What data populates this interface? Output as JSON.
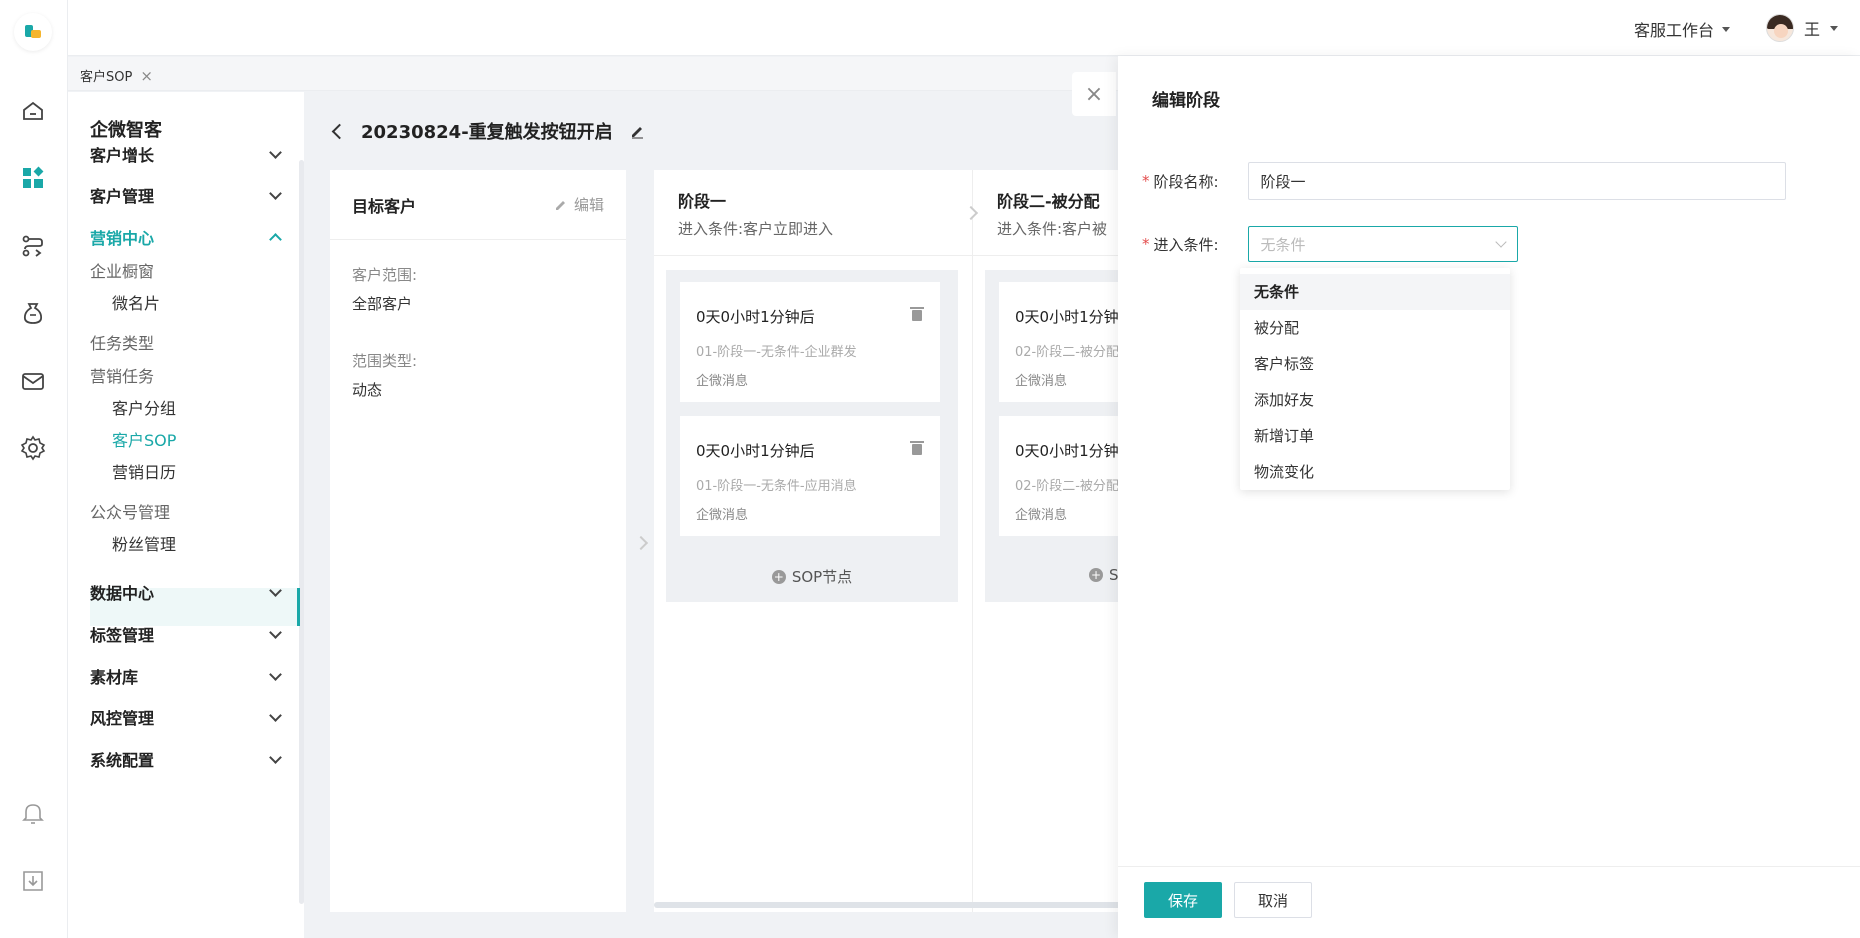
{
  "topbar": {
    "workbench_label": "客服工作台",
    "user_name": "王"
  },
  "tabs": [
    {
      "label": "客户SOP"
    }
  ],
  "menu": {
    "brand": "企微智客",
    "groups": {
      "growth": "客户增长",
      "manage": "客户管理",
      "marketing": "营销中心",
      "data": "数据中心",
      "tags": "标签管理",
      "materials": "素材库",
      "risk": "风控管理",
      "system": "系统配置"
    },
    "subs": {
      "showcase": "企业橱窗",
      "card": "微名片",
      "task_type": "任务类型",
      "task": "营销任务",
      "group": "客户分组",
      "sop": "客户SOP",
      "calendar": "营销日历",
      "mp": "公众号管理",
      "fans": "粉丝管理"
    }
  },
  "page": {
    "title": "20230824-重复触发按钮开启",
    "target_card": {
      "title": "目标客户",
      "edit_label": "编辑",
      "range_label": "客户范围:",
      "range_value": "全部客户",
      "type_label": "范围类型:",
      "type_value": "动态"
    },
    "stages": [
      {
        "name": "阶段一",
        "condition": "进入条件:客户立即进入",
        "nodes": [
          {
            "time": "0天0小时1分钟后",
            "desc": "01-阶段一-无条件-企业群发",
            "channel": "企微消息"
          },
          {
            "time": "0天0小时1分钟后",
            "desc": "01-阶段一-无条件-应用消息",
            "channel": "企微消息"
          }
        ],
        "add_label": "SOP节点"
      },
      {
        "name": "阶段二-被分配",
        "condition": "进入条件:客户被",
        "nodes": [
          {
            "time": "0天0小时1分钟",
            "desc": "02-阶段二-被分配",
            "channel": "企微消息"
          },
          {
            "time": "0天0小时1分钟",
            "desc": "02-阶段二-被分配",
            "channel": "企微消息"
          }
        ],
        "add_label": "S"
      }
    ]
  },
  "drawer": {
    "title": "编辑阶段",
    "name_label": "阶段名称:",
    "name_value": "阶段一",
    "cond_label": "进入条件:",
    "cond_placeholder": "无条件",
    "options": [
      "无条件",
      "被分配",
      "客户标签",
      "添加好友",
      "新增订单",
      "物流变化"
    ],
    "save_label": "保存",
    "cancel_label": "取消"
  },
  "colors": {
    "accent": "#1aa8a8",
    "required": "#e34d4d"
  }
}
